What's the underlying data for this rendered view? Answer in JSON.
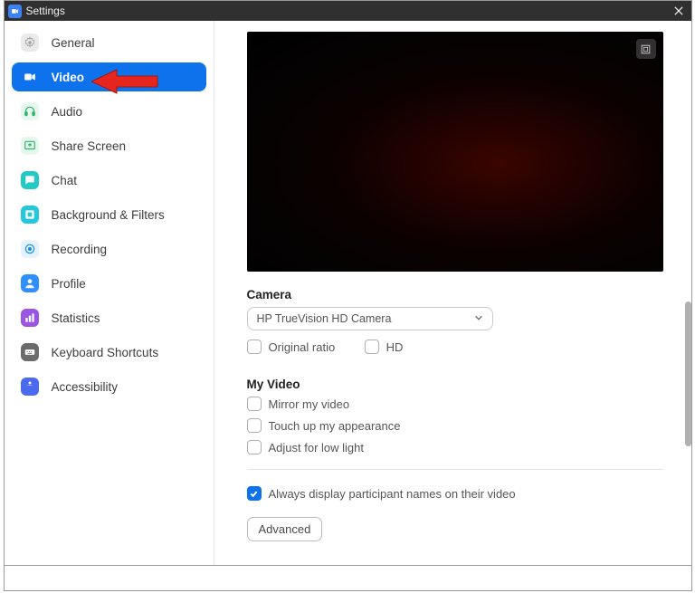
{
  "titlebar": {
    "title": "Settings"
  },
  "sidebar": {
    "items": [
      {
        "label": "General"
      },
      {
        "label": "Video"
      },
      {
        "label": "Audio"
      },
      {
        "label": "Share Screen"
      },
      {
        "label": "Chat"
      },
      {
        "label": "Background & Filters"
      },
      {
        "label": "Recording"
      },
      {
        "label": "Profile"
      },
      {
        "label": "Statistics"
      },
      {
        "label": "Keyboard Shortcuts"
      },
      {
        "label": "Accessibility"
      }
    ]
  },
  "content": {
    "camera": {
      "label": "Camera",
      "selected": "HP TrueVision HD Camera",
      "original_ratio": "Original ratio",
      "hd": "HD"
    },
    "my_video": {
      "label": "My Video",
      "mirror": "Mirror my video",
      "touchup": "Touch up my appearance",
      "lowlight": "Adjust for low light"
    },
    "always_names": "Always display participant names on their video",
    "advanced": "Advanced"
  }
}
